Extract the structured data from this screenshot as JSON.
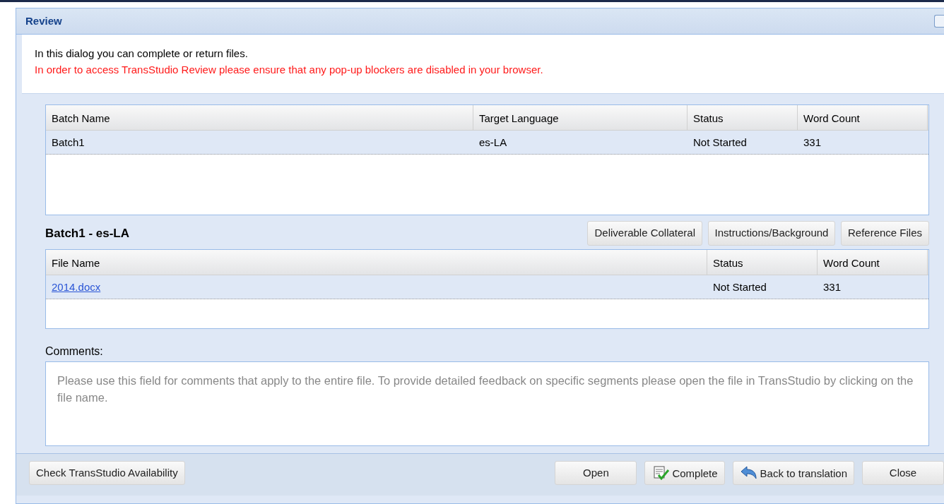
{
  "window": {
    "title": "Review"
  },
  "intro": {
    "text": "In this dialog you can complete or return files.",
    "warning": "In order to access TransStudio Review please ensure that any pop-up blockers are disabled in your browser."
  },
  "batch_table": {
    "columns": [
      "Batch Name",
      "Target Language",
      "Status",
      "Word Count"
    ],
    "rows": [
      {
        "cells": [
          "Batch1",
          "es-LA",
          "Not Started",
          "331"
        ],
        "selected": true
      }
    ]
  },
  "batch_heading": "Batch1 - es-LA",
  "batch_buttons": [
    "Deliverable Collateral",
    "Instructions/Background",
    "Reference Files"
  ],
  "file_table": {
    "columns": [
      "File Name",
      "Status",
      "Word Count"
    ],
    "rows": [
      {
        "cells": [
          "2014.docx",
          "Not Started",
          "331"
        ],
        "selected": true
      }
    ]
  },
  "comments": {
    "label": "Comments:",
    "placeholder": "Please use this field for comments that apply to the entire file. To provide detailed feedback on specific segments please open the file in TransStudio by clicking on the file name."
  },
  "footer": {
    "left": [
      {
        "label": "Check TransStudio Availability"
      }
    ],
    "right": [
      {
        "label": "Open",
        "kind": "plain"
      },
      {
        "label": "Complete",
        "kind": "complete"
      },
      {
        "label": "Back to translation",
        "kind": "back"
      },
      {
        "label": "Close",
        "kind": "plain"
      }
    ]
  }
}
